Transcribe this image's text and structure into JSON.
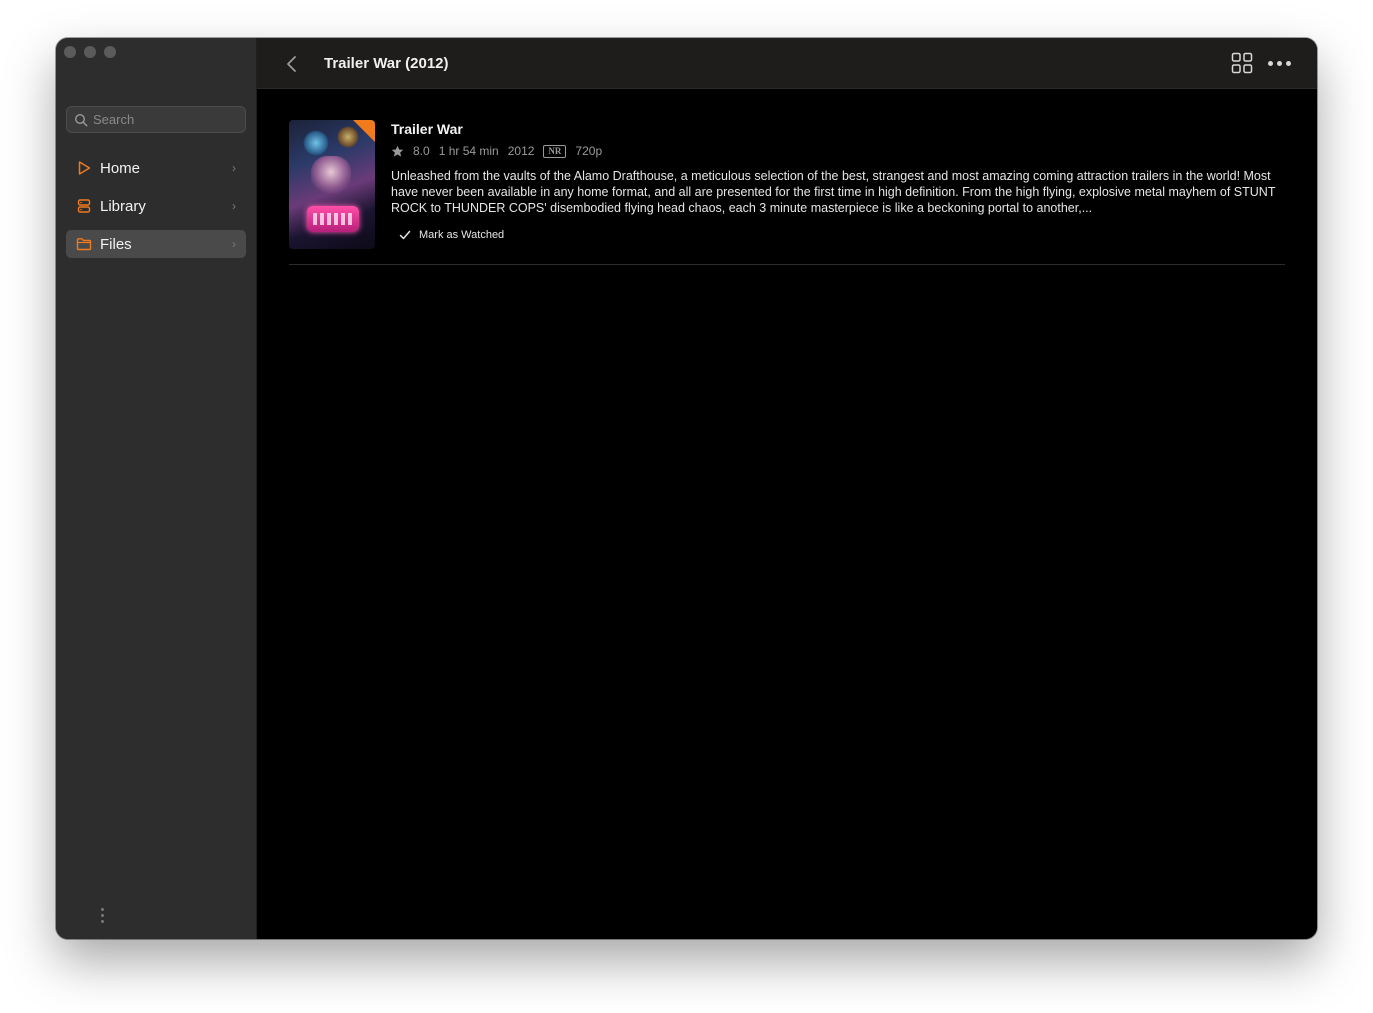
{
  "window": {
    "title": "Trailer War (2012)"
  },
  "sidebar": {
    "search_placeholder": "Search",
    "items": [
      {
        "label": "Home",
        "icon": "play-icon",
        "active": false
      },
      {
        "label": "Library",
        "icon": "library-icon",
        "active": false
      },
      {
        "label": "Files",
        "icon": "folder-icon",
        "active": true
      }
    ]
  },
  "toolbar": {
    "back_icon": "chevron-left-icon",
    "grid_icon": "grid-icon",
    "more_icon": "ellipsis-icon"
  },
  "media": {
    "title": "Trailer War",
    "rating": "8.0",
    "duration": "1 hr 54 min",
    "year": "2012",
    "content_rating": "NR",
    "resolution": "720p",
    "description": "Unleashed from the vaults of the Alamo Drafthouse, a meticulous selection of the best, strangest and most amazing coming attraction trailers in the world! Most have never been available in any home format, and all are presented for the first time in high definition. From the high flying, explosive metal mayhem of STUNT ROCK to THUNDER COPS' disembodied flying head chaos, each 3 minute masterpiece is like a beckoning portal to another,...",
    "mark_watched_label": "Mark as Watched"
  },
  "colors": {
    "accent": "#f07a1e",
    "sidebar_bg": "#2d2d2d",
    "topbar_bg": "#1f1d1c",
    "content_bg": "#000000"
  }
}
